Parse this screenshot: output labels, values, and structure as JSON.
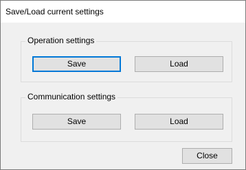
{
  "window": {
    "title": "Save/Load current settings"
  },
  "operation": {
    "group_label": "Operation settings",
    "save_label": "Save",
    "load_label": "Load"
  },
  "communication": {
    "group_label": "Communication settings",
    "save_label": "Save",
    "load_label": "Load"
  },
  "footer": {
    "close_label": "Close"
  },
  "colors": {
    "focus_border": "#0078d7",
    "button_face": "#e1e1e1"
  }
}
